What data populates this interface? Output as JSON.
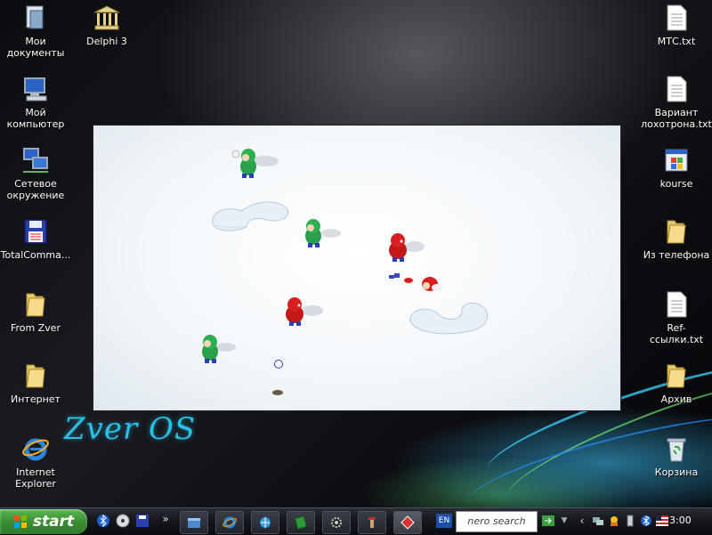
{
  "desktop": {
    "icons_left": [
      {
        "label": "Мои\nдокументы",
        "icon": "my-documents-icon"
      },
      {
        "label": "Delphi 3",
        "icon": "delphi-icon"
      },
      {
        "label": "Мой\nкомпьютер",
        "icon": "my-computer-icon"
      },
      {
        "label": "Сетевое\nокружение",
        "icon": "network-icon"
      },
      {
        "label": "TotalComma...",
        "icon": "floppy-icon"
      },
      {
        "label": "From Zver",
        "icon": "folder-icon"
      },
      {
        "label": "Интернет",
        "icon": "folder-icon"
      },
      {
        "label": "Internet\nExplorer",
        "icon": "ie-icon"
      }
    ],
    "icons_right": [
      {
        "label": "МТС.txt",
        "icon": "text-file-icon"
      },
      {
        "label": "Вариант\nлохотрона.txt",
        "icon": "text-file-icon"
      },
      {
        "label": "kourse",
        "icon": "app-window-icon"
      },
      {
        "label": "Из телефона",
        "icon": "folder-icon"
      },
      {
        "label": "Ref-ссылки.txt",
        "icon": "text-file-icon"
      },
      {
        "label": "Архив",
        "icon": "folder-icon"
      },
      {
        "label": "Корзина",
        "icon": "recycle-bin-icon"
      }
    ],
    "logo_text": "Zver OS"
  },
  "game": {
    "players_green": [
      {
        "name": "green-player-1"
      },
      {
        "name": "green-player-2"
      },
      {
        "name": "green-player-3"
      }
    ],
    "players_red": [
      {
        "name": "red-player-1"
      },
      {
        "name": "red-player-2"
      },
      {
        "name": "red-player-3-down"
      }
    ]
  },
  "taskbar": {
    "start_label": "start",
    "lang": "EN",
    "search_brand": "nero search",
    "clock": "3:00",
    "colors": {
      "start": "#3b8f33",
      "accent": "#29c0e8"
    }
  }
}
